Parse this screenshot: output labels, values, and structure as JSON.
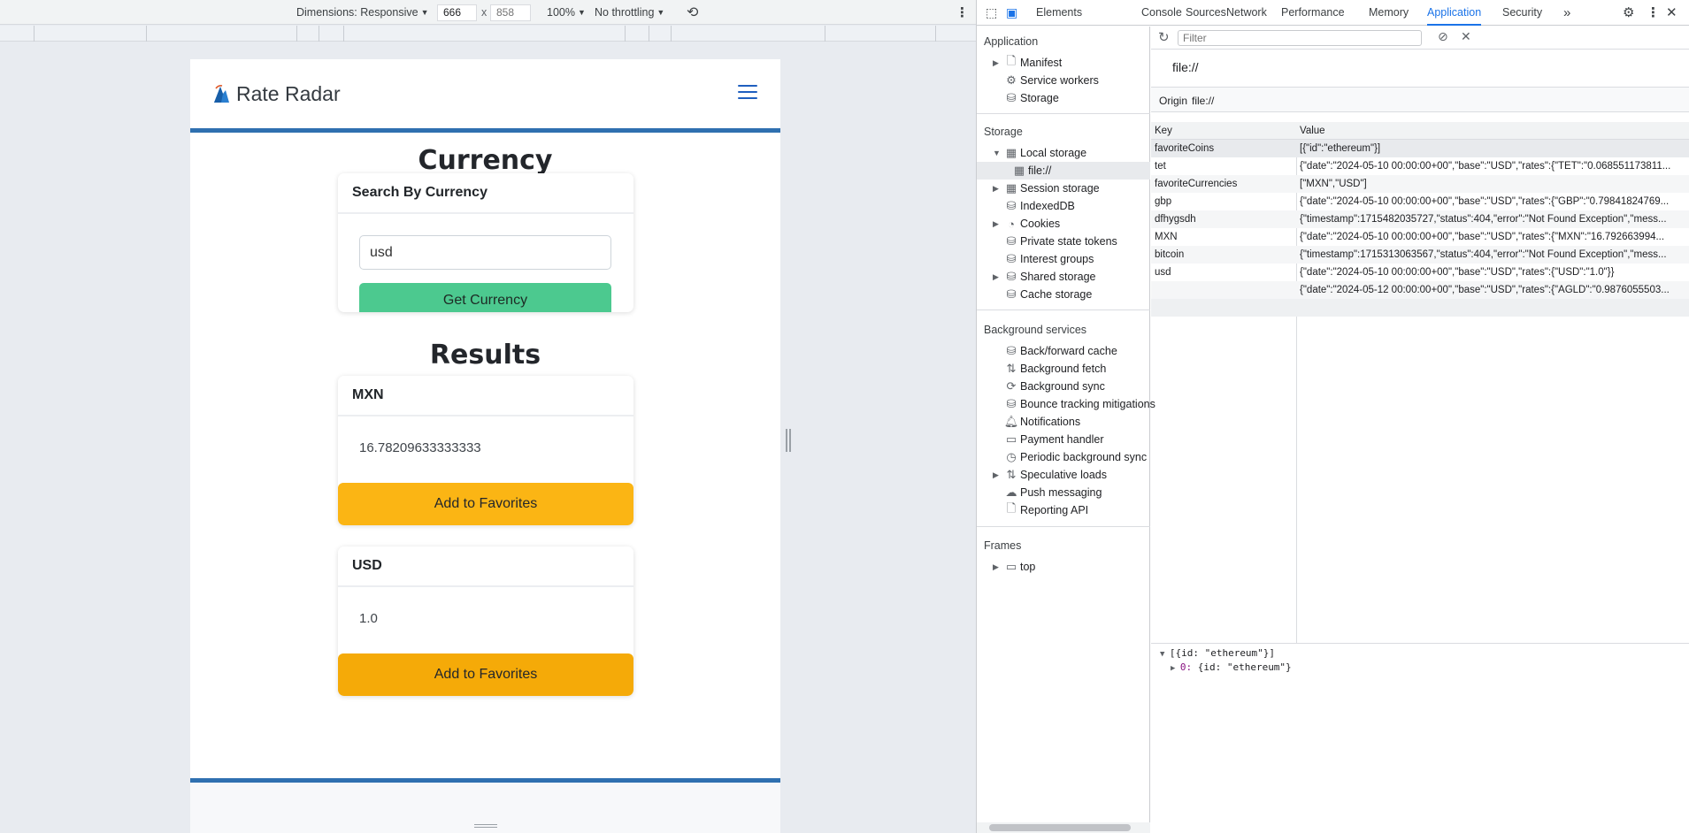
{
  "emulation_toolbar": {
    "dimensions_label": "Dimensions: Responsive",
    "width_value": "666",
    "height_placeholder": "858",
    "dimension_separator": "x",
    "zoom_label": "100%",
    "throttling_label": "No throttling"
  },
  "app": {
    "brand_name": "Rate Radar",
    "page_title": "Currency",
    "search_card": {
      "header": "Search By Currency",
      "input_value": "usd",
      "button_label": "Get Currency"
    },
    "results_title": "Results",
    "results": [
      {
        "code": "MXN",
        "value": "16.78209633333333",
        "button_label": "Add to Favorites"
      },
      {
        "code": "USD",
        "value": "1.0",
        "button_label": "Add to Favorites"
      }
    ],
    "colors": {
      "accent_blue": "#2f70b0",
      "button_green": "#4cc98f",
      "button_yellow": "#fbb514"
    }
  },
  "devtools": {
    "tabs": [
      "Elements",
      "Console",
      "Sources",
      "Network",
      "Performance",
      "Memory",
      "Application",
      "Security"
    ],
    "more_tabs": "»",
    "active_tab": "Application",
    "sidebar": {
      "application_header": "Application",
      "application_items": [
        "Manifest",
        "Service workers",
        "Storage"
      ],
      "storage_header": "Storage",
      "storage_items": [
        "Local storage",
        "file://",
        "Session storage",
        "IndexedDB",
        "Cookies",
        "Private state tokens",
        "Interest groups",
        "Shared storage",
        "Cache storage"
      ],
      "background_header": "Background services",
      "background_items": [
        "Back/forward cache",
        "Background fetch",
        "Background sync",
        "Bounce tracking mitigations",
        "Notifications",
        "Payment handler",
        "Periodic background sync",
        "Speculative loads",
        "Push messaging",
        "Reporting API"
      ],
      "frames_header": "Frames",
      "frames_items": [
        "top"
      ]
    },
    "main": {
      "filter_placeholder": "Filter",
      "origin_title": "file://",
      "origin_label": "Origin",
      "origin_value": "file://",
      "columns": [
        "Key",
        "Value"
      ],
      "rows": [
        {
          "key": "favoriteCoins",
          "value": "[{\"id\":\"ethereum\"}]"
        },
        {
          "key": "tet",
          "value": "{\"date\":\"2024-05-10 00:00:00+00\",\"base\":\"USD\",\"rates\":{\"TET\":\"0.068551173811..."
        },
        {
          "key": "favoriteCurrencies",
          "value": "[\"MXN\",\"USD\"]"
        },
        {
          "key": "gbp",
          "value": "{\"date\":\"2024-05-10 00:00:00+00\",\"base\":\"USD\",\"rates\":{\"GBP\":\"0.79841824769..."
        },
        {
          "key": "dfhygsdh",
          "value": "{\"timestamp\":1715482035727,\"status\":404,\"error\":\"Not Found Exception\",\"mess..."
        },
        {
          "key": "MXN",
          "value": "{\"date\":\"2024-05-10 00:00:00+00\",\"base\":\"USD\",\"rates\":{\"MXN\":\"16.792663994..."
        },
        {
          "key": "bitcoin",
          "value": "{\"timestamp\":1715313063567,\"status\":404,\"error\":\"Not Found Exception\",\"mess..."
        },
        {
          "key": "usd",
          "value": "{\"date\":\"2024-05-10 00:00:00+00\",\"base\":\"USD\",\"rates\":{\"USD\":\"1.0\"}}"
        },
        {
          "key": "",
          "value": "{\"date\":\"2024-05-12 00:00:00+00\",\"base\":\"USD\",\"rates\":{\"AGLD\":\"0.9876055503..."
        }
      ],
      "preview_line1": "[{id: \"ethereum\"}]",
      "preview_line2_key": "0:",
      "preview_line2_value": "{id: \"ethereum\"}"
    }
  }
}
